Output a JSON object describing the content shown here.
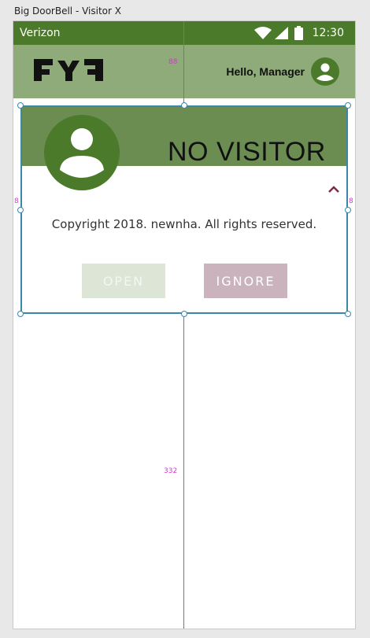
{
  "window": {
    "title": "Big DoorBell - Visitor X"
  },
  "status_bar": {
    "carrier": "Verizon",
    "time": "12:30",
    "icons": [
      "wifi-icon",
      "signal-icon",
      "battery-icon"
    ]
  },
  "app_bar": {
    "logo": "FYF",
    "greeting": "Hello, Manager",
    "avatar_icon": "user-avatar-icon"
  },
  "visitor_card": {
    "status": "NO VISITOR",
    "avatar_icon": "visitor-avatar-icon",
    "collapse_icon": "chevron-up-icon",
    "copyright": "Copyright 2018. newnha. All rights reserved.",
    "open_label": "OPEN",
    "ignore_label": "IGNORE"
  },
  "guides": {
    "top_spacing": "88",
    "left_spacing": "8",
    "right_spacing": "8",
    "bottom_spacing": "332"
  },
  "colors": {
    "status_bar": "#4a7a2a",
    "app_bar": "#8eab79",
    "card_header": "#6b8d51",
    "avatar": "#4a7a2a",
    "open_button": "#dde6d6",
    "ignore_button": "#cbb3bd",
    "chevron": "#7a2a4a",
    "selection": "#3a88a8",
    "guide": "#d03cc8"
  }
}
